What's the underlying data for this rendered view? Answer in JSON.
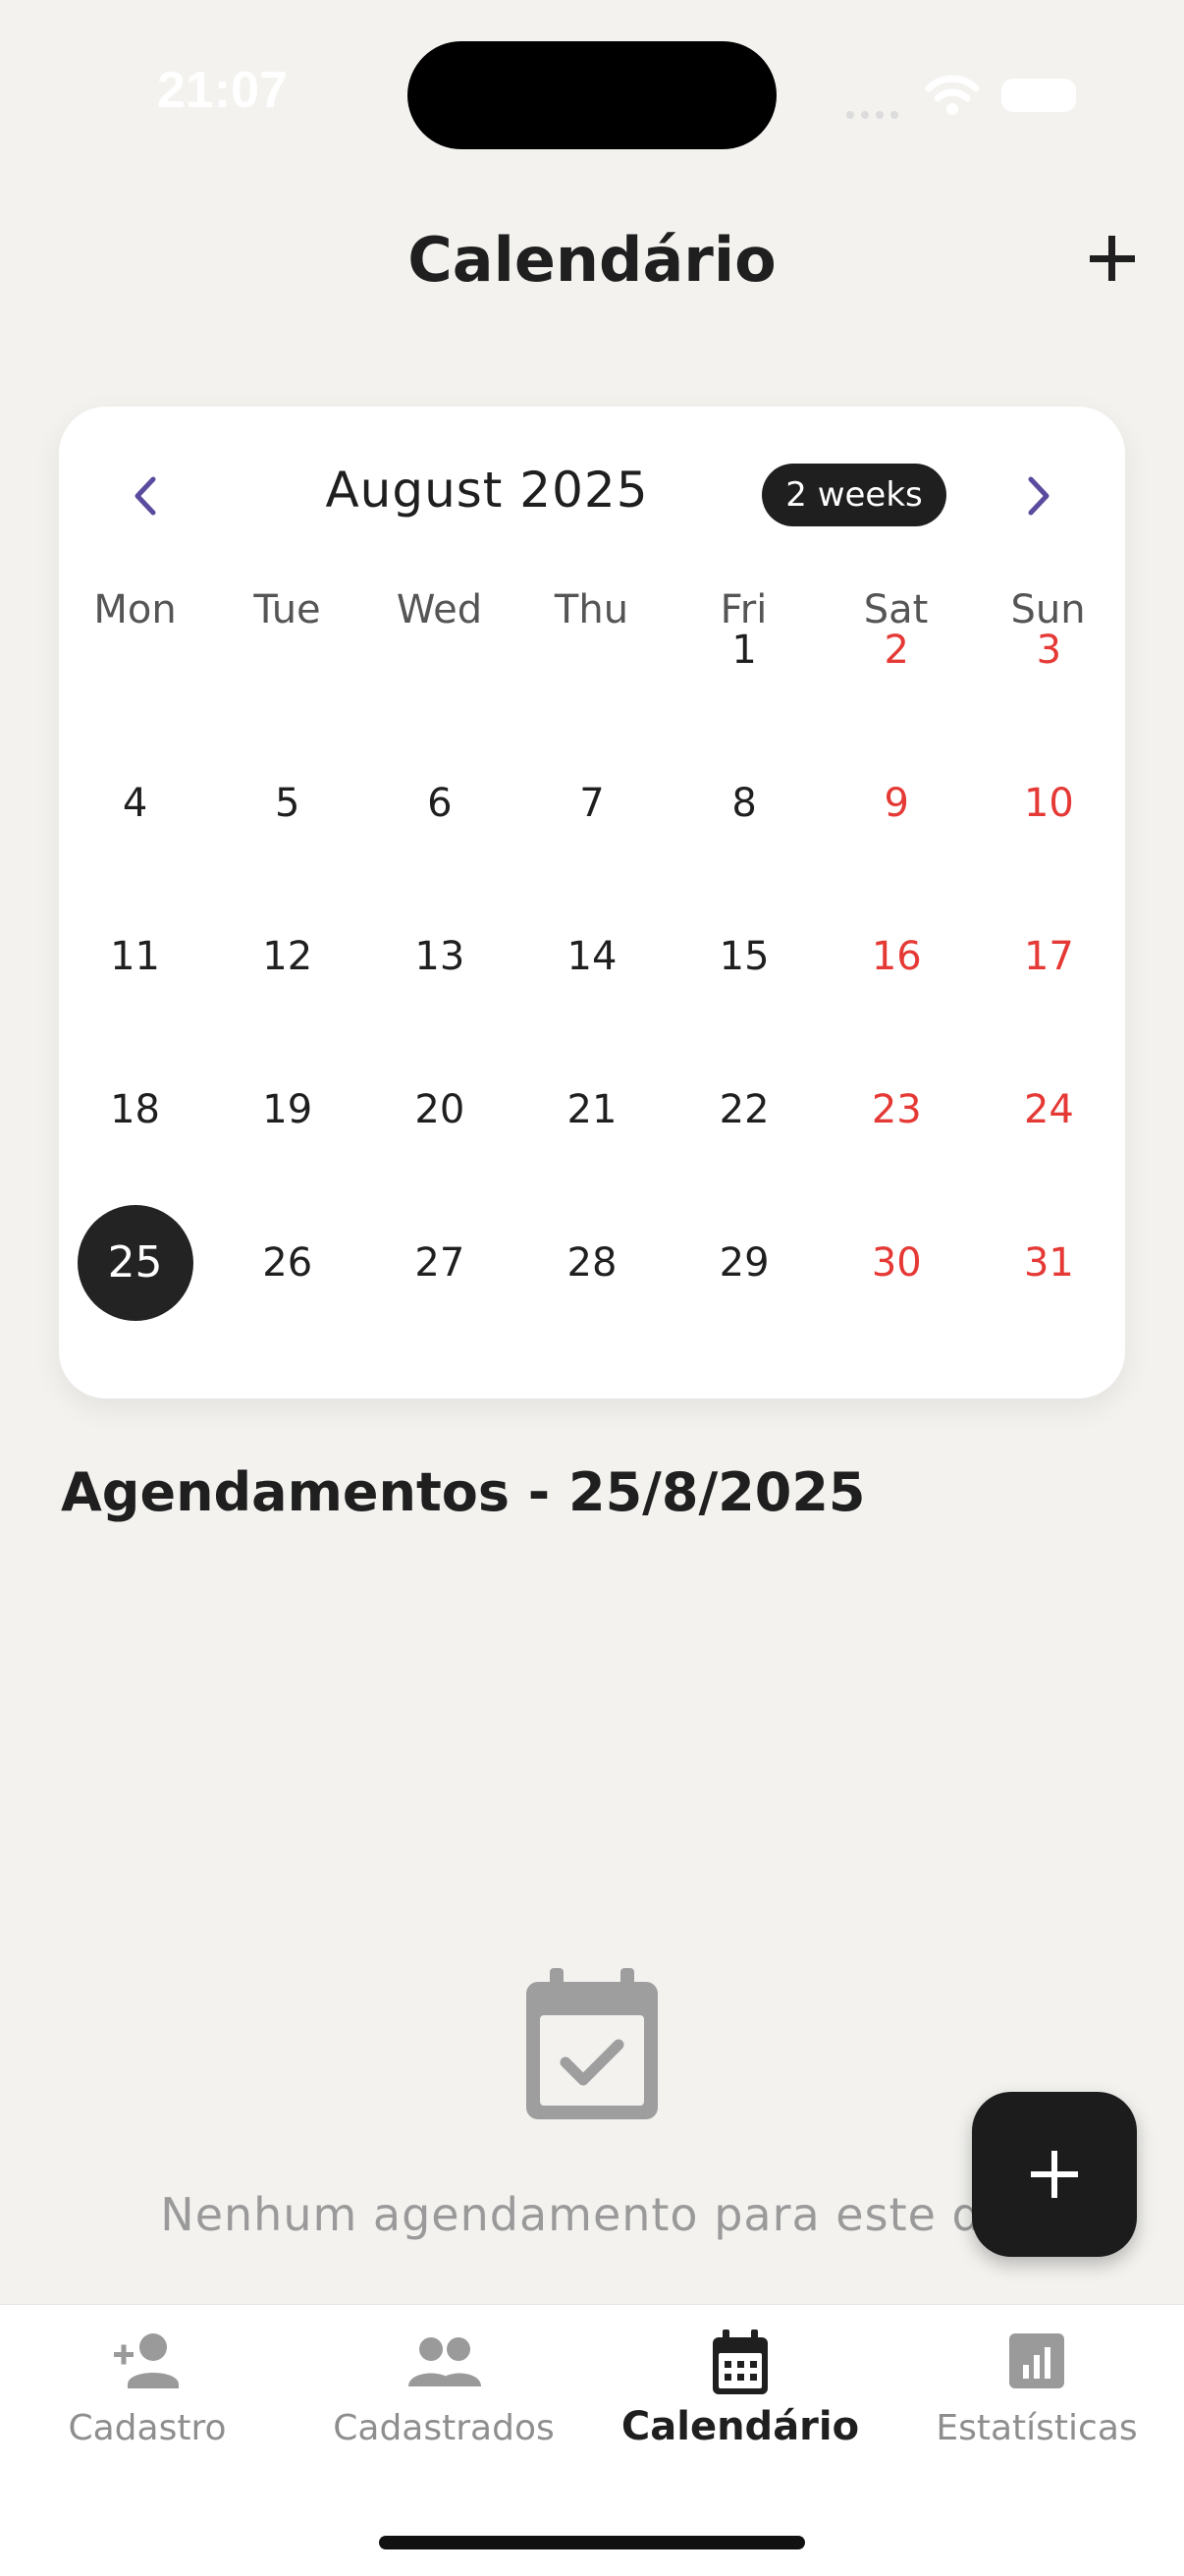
{
  "status_bar": {
    "time": "21:07"
  },
  "header": {
    "title": "Calendário",
    "add_icon": "plus-icon"
  },
  "calendar": {
    "month_label": "August 2025",
    "format_button": "2 weeks",
    "prev_icon": "chevron-left-icon",
    "next_icon": "chevron-right-icon",
    "weekdays": [
      "Mon",
      "Tue",
      "Wed",
      "Thu",
      "Fri",
      "Sat",
      "Sun"
    ],
    "weeks": [
      [
        "",
        "",
        "",
        "",
        "1",
        "2",
        "3"
      ],
      [
        "4",
        "5",
        "6",
        "7",
        "8",
        "9",
        "10"
      ],
      [
        "11",
        "12",
        "13",
        "14",
        "15",
        "16",
        "17"
      ],
      [
        "18",
        "19",
        "20",
        "21",
        "22",
        "23",
        "24"
      ],
      [
        "25",
        "26",
        "27",
        "28",
        "29",
        "30",
        "31"
      ]
    ],
    "selected_day": "25",
    "weekend_color": "#E53935",
    "selected_color": "#232323"
  },
  "appointments": {
    "title": "Agendamentos - 25/8/2025",
    "empty_icon": "calendar-check-icon",
    "empty_text": "Nenhum agendamento para este dia"
  },
  "fab": {
    "icon": "plus-icon"
  },
  "bottom_nav": {
    "items": [
      {
        "label": "Cadastro",
        "icon": "person-add-icon",
        "active": false
      },
      {
        "label": "Cadastrados",
        "icon": "people-icon",
        "active": false
      },
      {
        "label": "Calendário",
        "icon": "calendar-month-icon",
        "active": true
      },
      {
        "label": "Estatísticas",
        "icon": "bar-chart-icon",
        "active": false
      }
    ]
  }
}
